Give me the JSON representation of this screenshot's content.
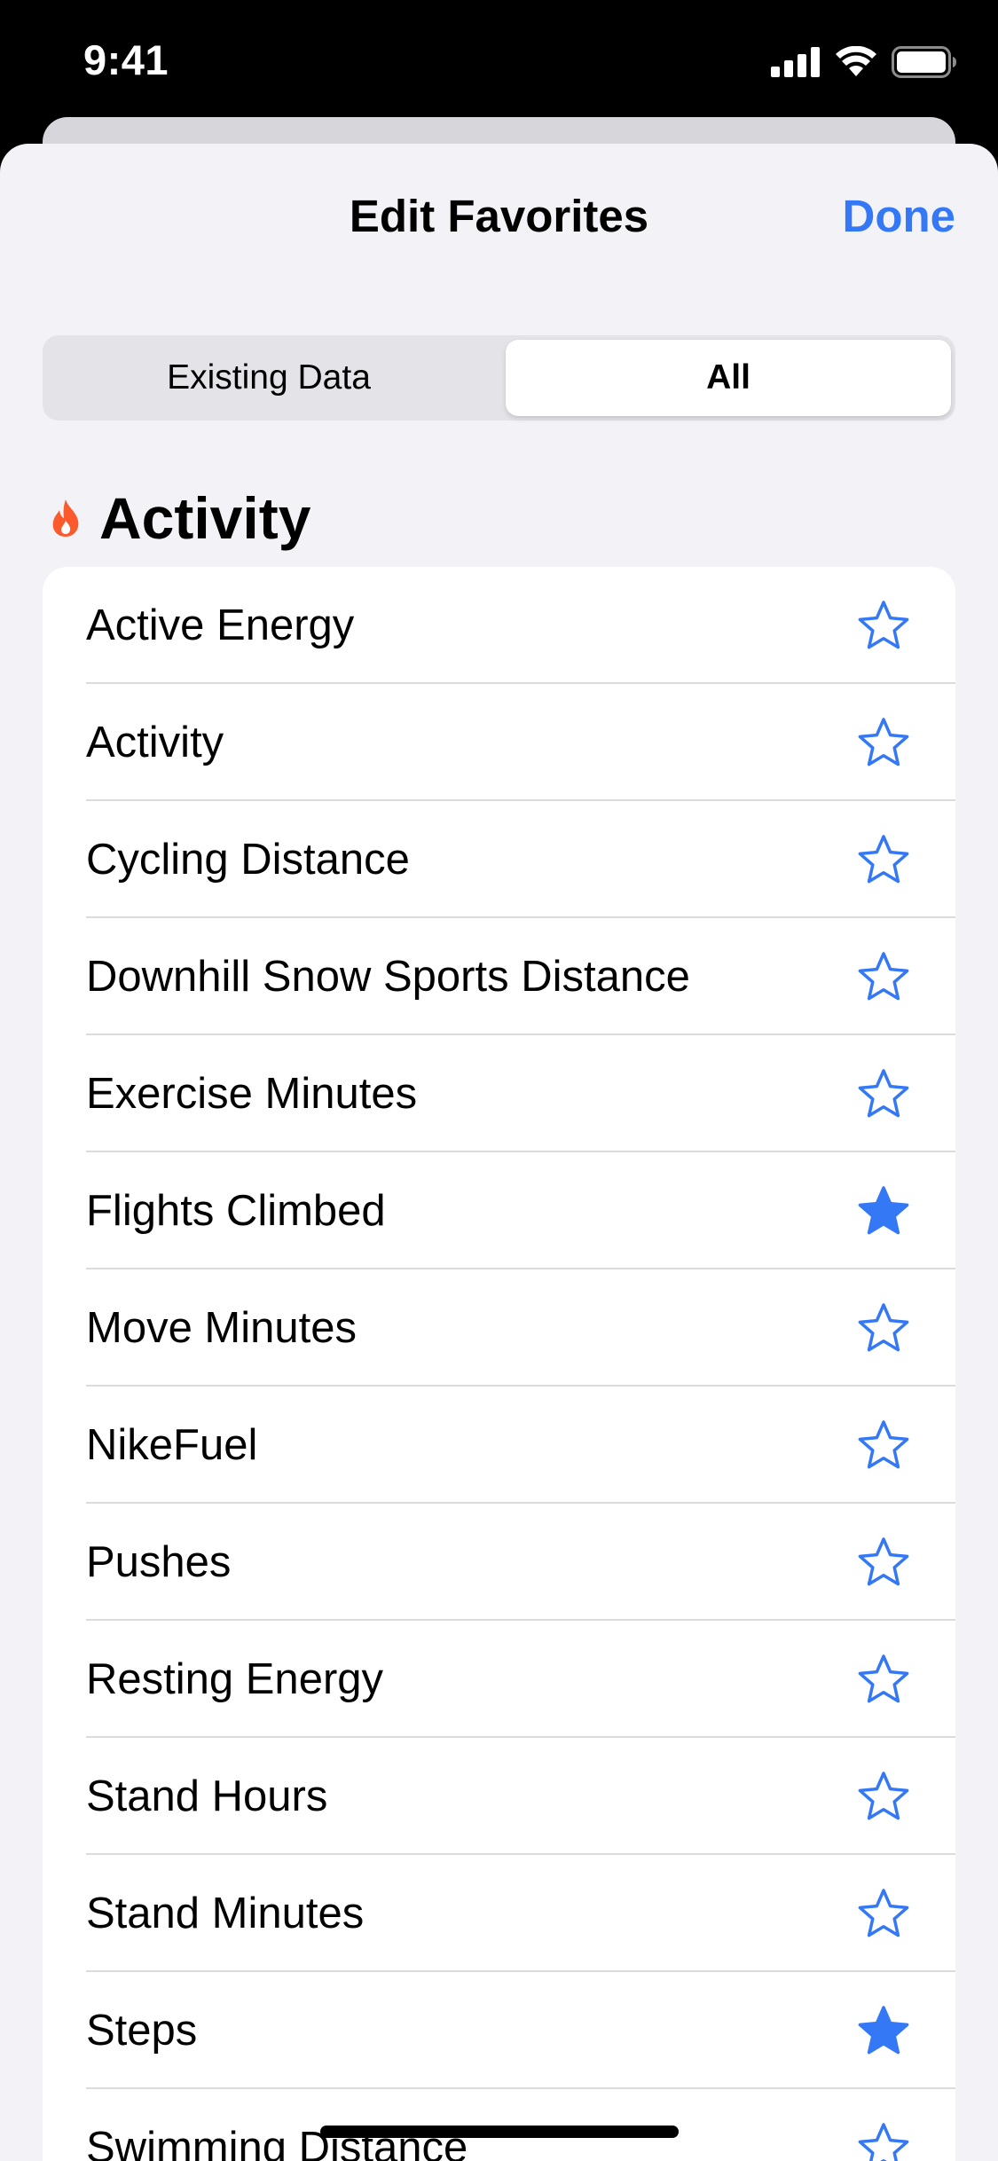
{
  "status_bar": {
    "time": "9:41",
    "icons": [
      "cellular-signal-icon",
      "wifi-icon",
      "battery-icon"
    ]
  },
  "nav": {
    "title": "Edit Favorites",
    "done_label": "Done"
  },
  "segmented_control": {
    "options": [
      "Existing Data",
      "All"
    ],
    "selected": "All"
  },
  "section": {
    "title": "Activity",
    "icon": "flame-icon"
  },
  "items": [
    {
      "label": "Active Energy",
      "favorite": false
    },
    {
      "label": "Activity",
      "favorite": false
    },
    {
      "label": "Cycling Distance",
      "favorite": false
    },
    {
      "label": "Downhill Snow Sports Distance",
      "favorite": false
    },
    {
      "label": "Exercise Minutes",
      "favorite": false
    },
    {
      "label": "Flights Climbed",
      "favorite": true
    },
    {
      "label": "Move Minutes",
      "favorite": false
    },
    {
      "label": "NikeFuel",
      "favorite": false
    },
    {
      "label": "Pushes",
      "favorite": false
    },
    {
      "label": "Resting Energy",
      "favorite": false
    },
    {
      "label": "Stand Hours",
      "favorite": false
    },
    {
      "label": "Stand Minutes",
      "favorite": false
    },
    {
      "label": "Steps",
      "favorite": true
    },
    {
      "label": "Swimming Distance",
      "favorite": false
    }
  ],
  "colors": {
    "accent": "#3478f6",
    "activity": "#fa5a2c",
    "background": "#f2f2f7"
  }
}
